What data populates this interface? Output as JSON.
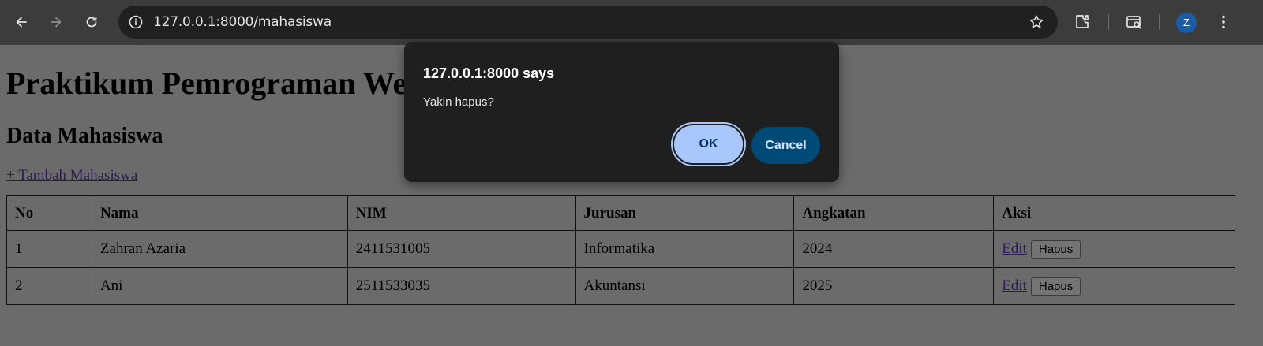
{
  "browser": {
    "url": "127.0.0.1:8000/mahasiswa",
    "profile_initial": "Z",
    "icons": [
      "back-icon",
      "forward-icon",
      "reload-icon",
      "info-icon",
      "star-icon",
      "extensions-icon",
      "tab-search-icon",
      "menu-icon"
    ]
  },
  "page": {
    "heading": "Praktikum Pemrograman Web",
    "subheading": "Data Mahasiswa",
    "add_link": "+ Tambah Mahasiswa",
    "table": {
      "headers": [
        "No",
        "Nama",
        "NIM",
        "Jurusan",
        "Angkatan",
        "Aksi"
      ],
      "rows": [
        {
          "no": "1",
          "nama": "Zahran Azaria",
          "nim": "2411531005",
          "jurusan": "Informatika",
          "angkatan": "2024",
          "edit": "Edit",
          "hapus": "Hapus"
        },
        {
          "no": "2",
          "nama": "Ani",
          "nim": "2511533035",
          "jurusan": "Akuntansi",
          "angkatan": "2025",
          "edit": "Edit",
          "hapus": "Hapus"
        }
      ]
    }
  },
  "dialog": {
    "title": "127.0.0.1:8000 says",
    "message": "Yakin hapus?",
    "ok_label": "OK",
    "cancel_label": "Cancel"
  },
  "colors": {
    "toolbar_bg": "#3c3c3c",
    "omnibox_bg": "#202020",
    "page_dim": "#6b6b6b",
    "dialog_bg": "#1f1f1f",
    "ok_bg": "#a8c7fa",
    "cancel_bg": "#004a77",
    "avatar_bg": "#1a5ca8"
  }
}
